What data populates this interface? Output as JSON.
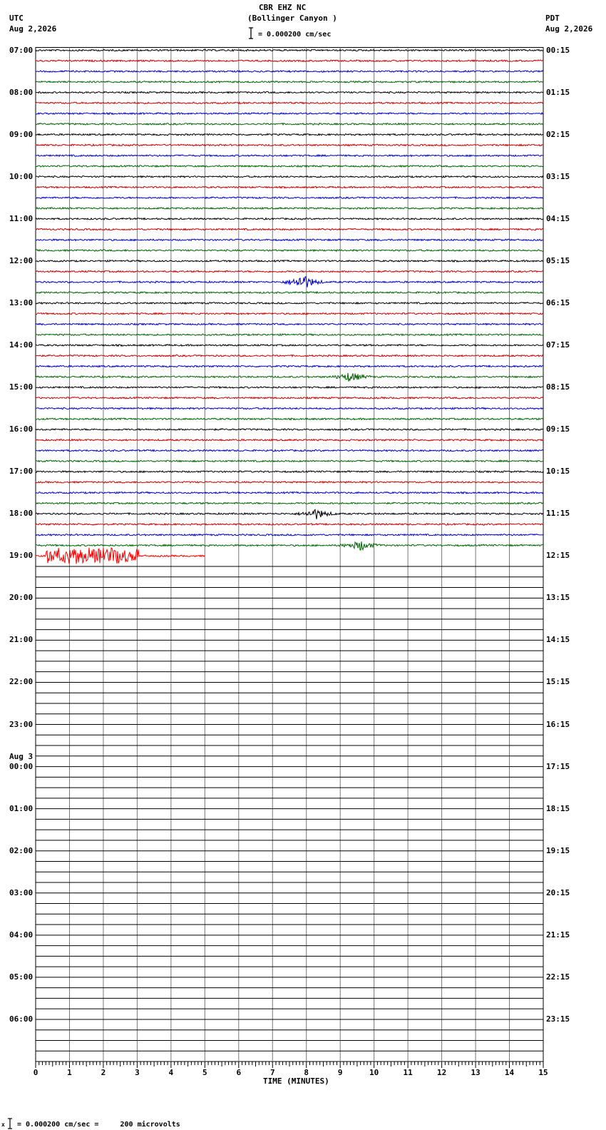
{
  "header": {
    "station": "CBR EHZ NC",
    "location": "(Bollinger Canyon )",
    "scale_text": "= 0.000200 cm/sec",
    "left_tz": "UTC",
    "left_date": "Aug 2,2026",
    "right_tz": "PDT",
    "right_date": "Aug 2,2026"
  },
  "footer": {
    "scale_text": "= 0.000200 cm/sec =     200 microvolts"
  },
  "chart_data": {
    "type": "line",
    "title": "CBR EHZ NC (Bollinger Canyon )",
    "xlabel": "TIME (MINUTES)",
    "xlim": [
      0,
      15
    ],
    "x_ticks": [
      "0",
      "1",
      "2",
      "3",
      "4",
      "5",
      "6",
      "7",
      "8",
      "9",
      "10",
      "11",
      "12",
      "13",
      "14",
      "15"
    ],
    "trace_colors": [
      "#000000",
      "#cc0000",
      "#0000cc",
      "#006600"
    ],
    "rows_per_hour": 4,
    "rows_total": 96,
    "recorded_rows": 49,
    "left_labels": [
      "07:00",
      "08:00",
      "09:00",
      "10:00",
      "11:00",
      "12:00",
      "13:00",
      "14:00",
      "15:00",
      "16:00",
      "17:00",
      "18:00",
      "19:00",
      "20:00",
      "21:00",
      "22:00",
      "23:00",
      "00:00",
      "01:00",
      "02:00",
      "03:00",
      "04:00",
      "05:00",
      "06:00"
    ],
    "date_change_label": "Aug 3",
    "right_labels": [
      "00:15",
      "01:15",
      "02:15",
      "03:15",
      "04:15",
      "05:15",
      "06:15",
      "07:15",
      "08:15",
      "09:15",
      "10:15",
      "11:15",
      "12:15",
      "13:15",
      "14:15",
      "15:15",
      "16:15",
      "17:15",
      "18:15",
      "19:15",
      "20:15",
      "21:15",
      "22:15",
      "23:15"
    ],
    "last_row_end_minute": 5,
    "events": [
      {
        "row": 22,
        "minute": 7.9,
        "amplitude": "medium",
        "color": "#0000cc"
      },
      {
        "row": 31,
        "minute": 9.3,
        "amplitude": "small",
        "color": "#006600"
      },
      {
        "row": 44,
        "minute": 8.3,
        "amplitude": "small",
        "color": "#000000"
      },
      {
        "row": 47,
        "minute": 9.6,
        "amplitude": "small",
        "color": "#006600"
      },
      {
        "row": 49,
        "minute": 0.5,
        "amplitude": "large",
        "color": "#ff0000"
      },
      {
        "row": 49,
        "minute": 2.0,
        "amplitude": "large",
        "color": "#ff0000"
      }
    ]
  }
}
